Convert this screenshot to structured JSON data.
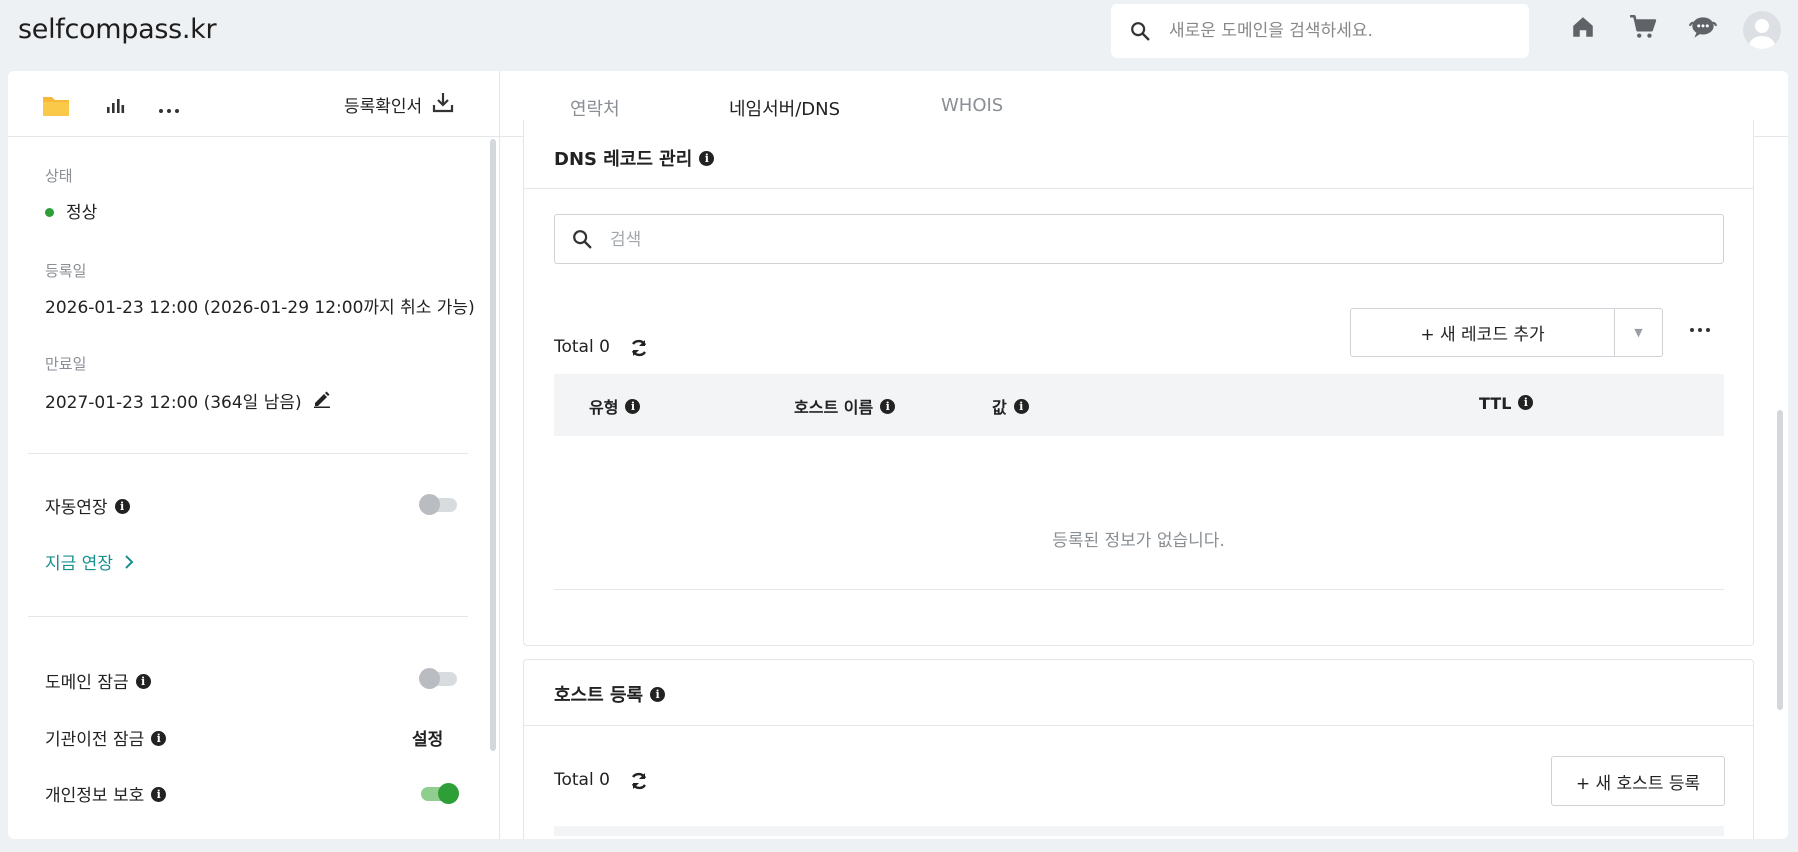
{
  "header": {
    "brand": "selfcompass.kr",
    "search_placeholder": "새로운 도메인을 검색하세요.",
    "icons": [
      "home-icon",
      "cart-icon",
      "support-chat-icon",
      "user-avatar-icon"
    ]
  },
  "left": {
    "toolbar": {
      "cert_label": "등록확인서"
    },
    "status": {
      "label": "상태",
      "value": "정상",
      "color": "#2e9e37"
    },
    "registered": {
      "label": "등록일",
      "value": "2026-01-23 12:00 (2026-01-29 12:00까지 취소 가능)"
    },
    "expiry": {
      "label": "만료일",
      "value": "2027-01-23 12:00 (364일 남음)"
    },
    "auto_renew": {
      "label": "자동연장",
      "enabled": false
    },
    "renew_now": "지금 연장",
    "domain_lock": {
      "label": "도메인 잠금",
      "enabled": false
    },
    "transfer_lock": {
      "label": "기관이전 잠금",
      "action": "설정"
    },
    "privacy": {
      "label": "개인정보 보호",
      "enabled": true
    }
  },
  "tabs": [
    {
      "label": "연락처",
      "active": false
    },
    {
      "label": "네임서버/DNS",
      "active": true
    },
    {
      "label": "WHOIS",
      "active": false
    }
  ],
  "dns": {
    "title": "DNS 레코드 관리",
    "search_placeholder": "검색",
    "total": "Total 0",
    "add_button": "+ 새 레코드 추가",
    "columns": [
      "유형",
      "호스트 이름",
      "값",
      "TTL"
    ],
    "empty_text": "등록된 정보가 없습니다."
  },
  "hosts": {
    "title": "호스트 등록",
    "total": "Total 0",
    "add_button": "+ 새 호스트 등록"
  },
  "colors": {
    "accent_tab": "#1f3b57",
    "link": "#1a8f8f",
    "on": "#2e9e37"
  }
}
